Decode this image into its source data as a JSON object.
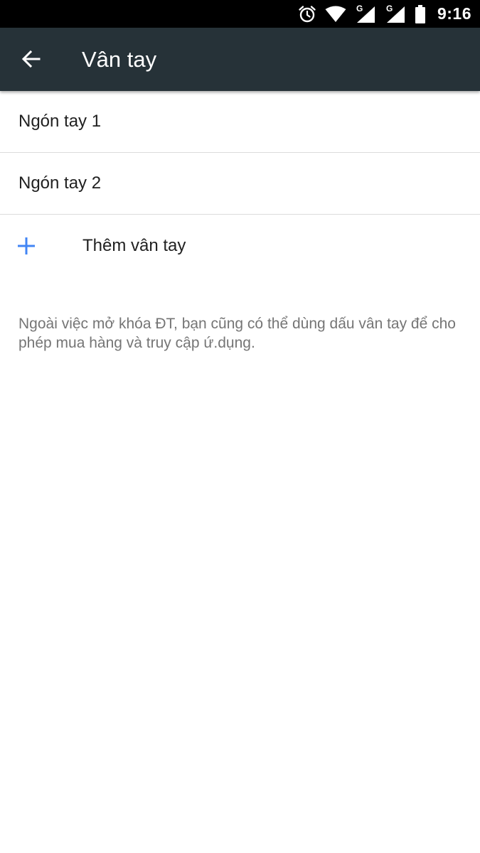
{
  "status_bar": {
    "time": "9:16",
    "icons": [
      "alarm-icon",
      "wifi-icon",
      "signal-g-icon",
      "signal-g-icon",
      "battery-icon"
    ],
    "network_label_1": "G",
    "network_label_2": "G"
  },
  "app_bar": {
    "title": "Vân tay",
    "back_icon": "arrow-left-icon",
    "background": "#263238"
  },
  "fingerprints": [
    {
      "label": "Ngón tay 1"
    },
    {
      "label": "Ngón tay 2"
    }
  ],
  "add_fingerprint": {
    "label": "Thêm vân tay",
    "icon": "plus-icon",
    "icon_color": "#4285f4"
  },
  "info": {
    "text": "Ngoài việc mở khóa ĐT, bạn cũng có thể dùng dấu vân tay để cho phép mua hàng và truy cập ứ.dụng."
  }
}
